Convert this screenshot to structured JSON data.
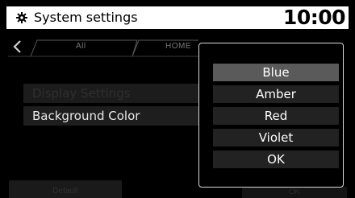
{
  "header": {
    "title": "System settings",
    "clock": "10:00",
    "icon": "gear-icon"
  },
  "tabs": [
    {
      "label": "All"
    },
    {
      "label": "HOME"
    }
  ],
  "settings_list": [
    {
      "label": "Display Settings",
      "state": "dimmed"
    },
    {
      "label": "Background Color",
      "state": "active"
    }
  ],
  "footer": {
    "default_label": "Default",
    "ok_label": "OK"
  },
  "color_popup": {
    "options": [
      {
        "label": "Blue",
        "selected": true
      },
      {
        "label": "Amber",
        "selected": false
      },
      {
        "label": "Red",
        "selected": false
      },
      {
        "label": "Violet",
        "selected": false
      },
      {
        "label": "OK",
        "selected": false
      }
    ]
  },
  "colors": {
    "titlebar_bg": "#ffffff",
    "screen_bg": "#000000",
    "selected_option": "#5a5a5a",
    "option_bg": "#222222"
  }
}
